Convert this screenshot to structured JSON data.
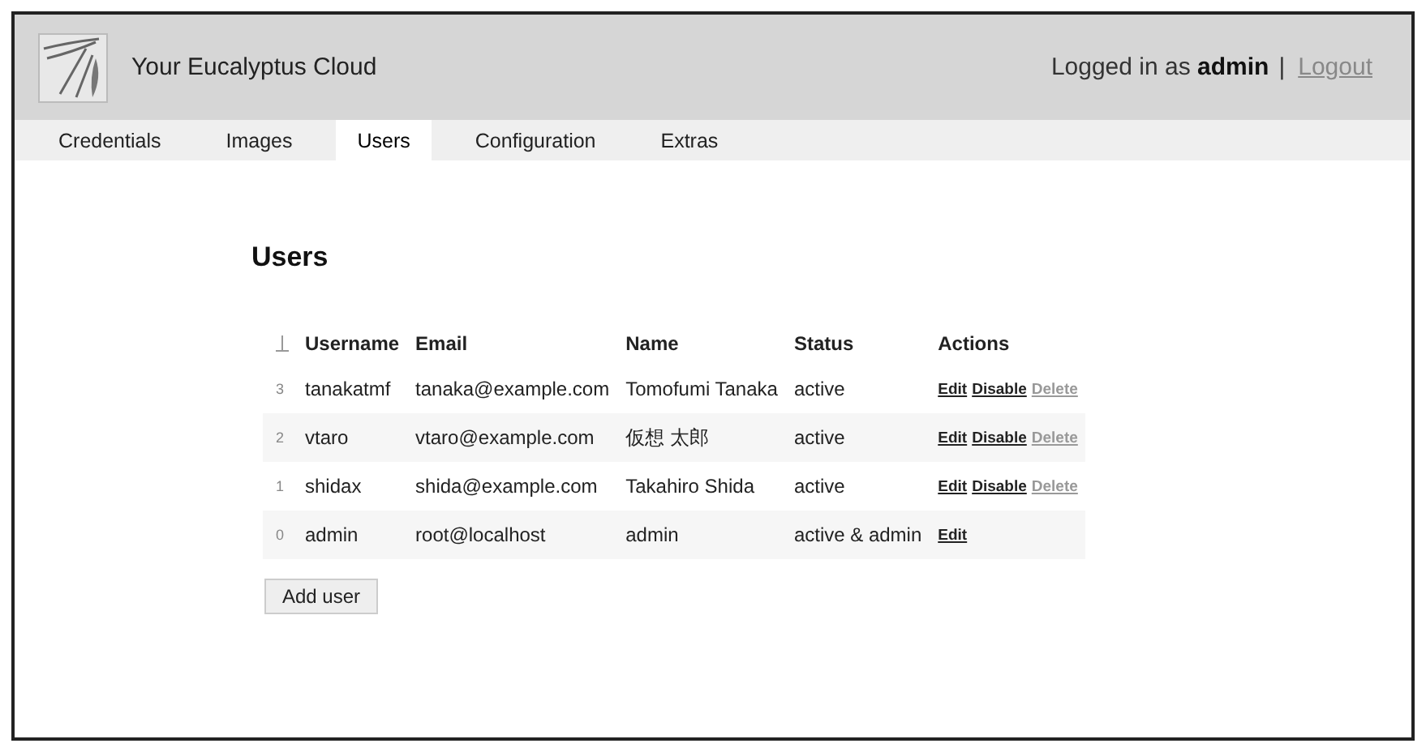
{
  "header": {
    "title": "Your Eucalyptus Cloud",
    "login_prefix": "Logged in as",
    "user": "admin",
    "separator": "|",
    "logout": "Logout"
  },
  "tabs": [
    {
      "label": "Credentials",
      "selected": false
    },
    {
      "label": "Images",
      "selected": false
    },
    {
      "label": "Users",
      "selected": true
    },
    {
      "label": "Configuration",
      "selected": false
    },
    {
      "label": "Extras",
      "selected": false
    }
  ],
  "heading": "Users",
  "table": {
    "columns": [
      "Username",
      "Email",
      "Name",
      "Status",
      "Actions"
    ],
    "rows": [
      {
        "index": "3",
        "username": "tanakatmf",
        "email": "tanaka@example.com",
        "name": "Tomofumi Tanaka",
        "status": "active",
        "actions": [
          {
            "label": "Edit",
            "disabled": false
          },
          {
            "label": "Disable",
            "disabled": false
          },
          {
            "label": "Delete",
            "disabled": true
          }
        ]
      },
      {
        "index": "2",
        "username": "vtaro",
        "email": "vtaro@example.com",
        "name": "仮想 太郎",
        "status": "active",
        "actions": [
          {
            "label": "Edit",
            "disabled": false
          },
          {
            "label": "Disable",
            "disabled": false
          },
          {
            "label": "Delete",
            "disabled": true
          }
        ]
      },
      {
        "index": "1",
        "username": "shidax",
        "email": "shida@example.com",
        "name": "Takahiro Shida",
        "status": "active",
        "actions": [
          {
            "label": "Edit",
            "disabled": false
          },
          {
            "label": "Disable",
            "disabled": false
          },
          {
            "label": "Delete",
            "disabled": true
          }
        ]
      },
      {
        "index": "0",
        "username": "admin",
        "email": "root@localhost",
        "name": "admin",
        "status": "active & admin",
        "actions": [
          {
            "label": "Edit",
            "disabled": false
          }
        ]
      }
    ]
  },
  "add_button": "Add user"
}
